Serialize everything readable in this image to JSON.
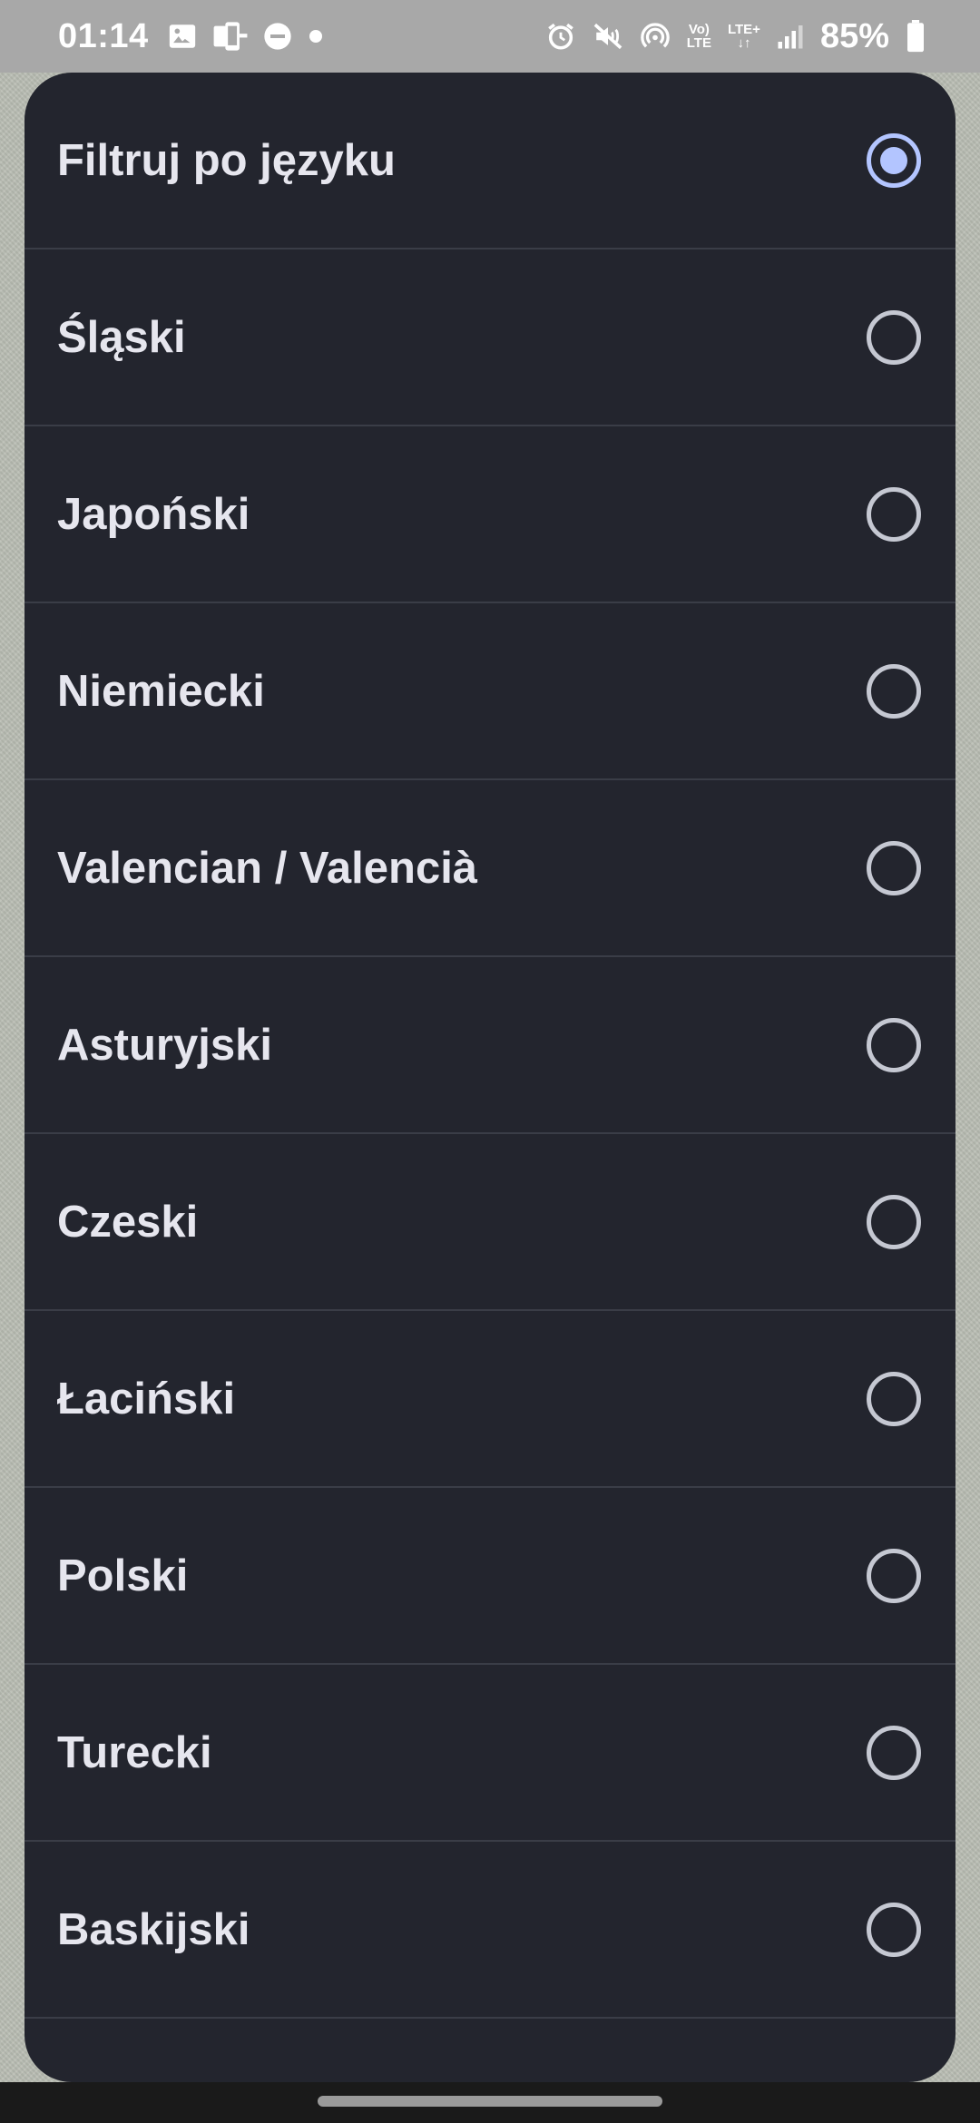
{
  "status_bar": {
    "time": "01:14",
    "battery": "85%",
    "volte_top": "Vo)",
    "volte_bottom": "LTE",
    "lte_plus_top": "LTE+",
    "lte_arrows": "↓↑",
    "icons_left": [
      "image-icon",
      "phone-transfer-icon",
      "do-not-disturb-icon",
      "dot-icon"
    ],
    "icons_right": [
      "alarm-icon",
      "mute-icon",
      "hotspot-icon",
      "volte-icon",
      "lte-plus-icon",
      "signal-icon",
      "battery-icon"
    ]
  },
  "dialog": {
    "options": [
      {
        "label": "Filtruj po języku",
        "checked": true
      },
      {
        "label": "Śląski",
        "checked": false
      },
      {
        "label": "Japoński",
        "checked": false
      },
      {
        "label": "Niemiecki",
        "checked": false
      },
      {
        "label": "Valencian / Valencià",
        "checked": false
      },
      {
        "label": "Asturyjski",
        "checked": false
      },
      {
        "label": "Czeski",
        "checked": false
      },
      {
        "label": "Łaciński",
        "checked": false
      },
      {
        "label": "Polski",
        "checked": false
      },
      {
        "label": "Turecki",
        "checked": false
      },
      {
        "label": "Baskijski",
        "checked": false
      }
    ]
  },
  "colors": {
    "dialog_bg": "#23252e",
    "accent": "#b3c5ff",
    "text": "#e6e6ee",
    "divider": "#3a3d47"
  }
}
